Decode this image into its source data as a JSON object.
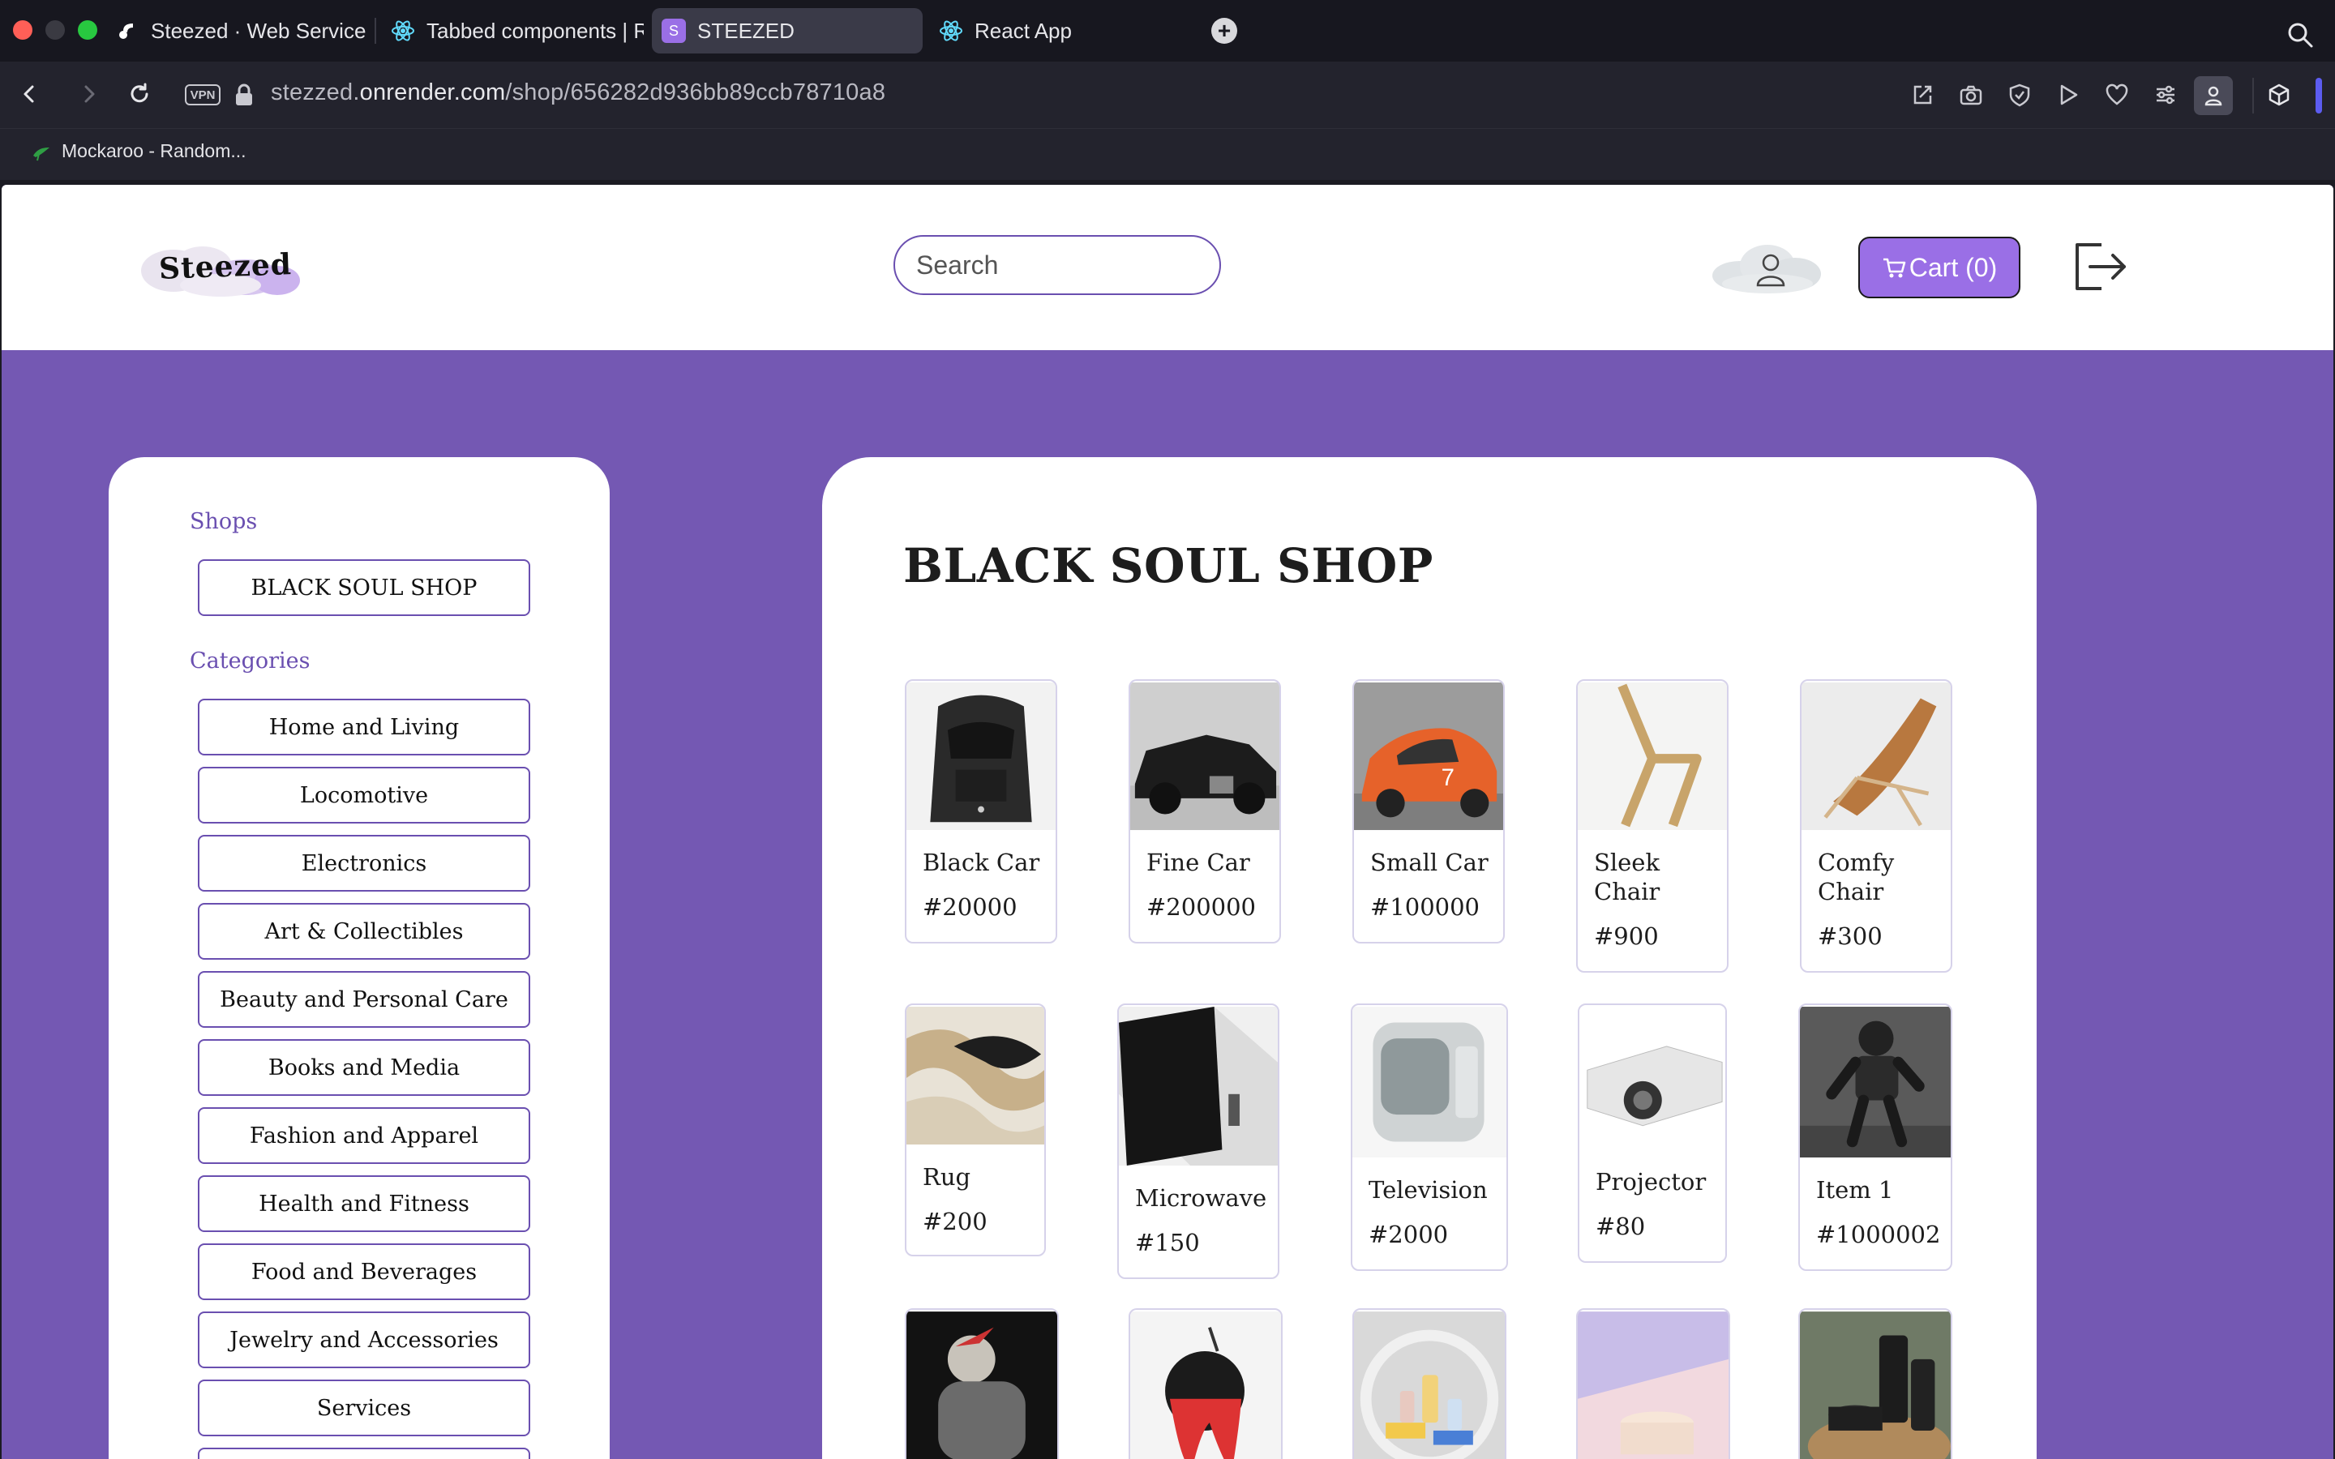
{
  "browser": {
    "tabs": [
      {
        "label": "Steezed · Web Service"
      },
      {
        "label": "Tabbed components | Re"
      },
      {
        "label": "STEEZED",
        "favicon_letter": "S"
      },
      {
        "label": "React App"
      }
    ],
    "url": {
      "host_prefix": "stezzed.",
      "host_main": "onrender.com",
      "path": "/shop/656282d936bb89ccb78710a8"
    },
    "vpn_label": "VPN",
    "bookmarks": [
      {
        "label": "Mockaroo - Random..."
      }
    ]
  },
  "header": {
    "logo_text": "Steezed",
    "search_placeholder": "Search",
    "cart_label": "Cart (0)"
  },
  "sidebar": {
    "shops_heading": "Shops",
    "shops": [
      "BLACK SOUL SHOP"
    ],
    "categories_heading": "Categories",
    "categories": [
      "Home and Living",
      "Locomotive",
      "Electronics",
      "Art & Collectibles",
      "Beauty and Personal Care",
      "Books and Media",
      "Fashion and Apparel",
      "Health and Fitness",
      "Food and Beverages",
      "Jewelry and Accessories",
      "Services"
    ]
  },
  "shop": {
    "title": "BLACK SOUL SHOP",
    "products": [
      {
        "name": "Black Car",
        "price": "#20000"
      },
      {
        "name": "Fine Car",
        "price": "#200000"
      },
      {
        "name": "Small Car",
        "price": "#100000"
      },
      {
        "name": "Sleek Chair",
        "price": "#900"
      },
      {
        "name": "Comfy Chair",
        "price": "#300"
      },
      {
        "name": "Rug",
        "price": "#200"
      },
      {
        "name": "Microwave",
        "price": "#150"
      },
      {
        "name": "Television",
        "price": "#2000"
      },
      {
        "name": "Projector",
        "price": "#80"
      },
      {
        "name": "Item 1",
        "price": "#1000002"
      }
    ]
  },
  "colors": {
    "brand_purple": "#7458b3",
    "cart_button": "#9a6fe6",
    "accent_border": "#6a4fb0"
  }
}
